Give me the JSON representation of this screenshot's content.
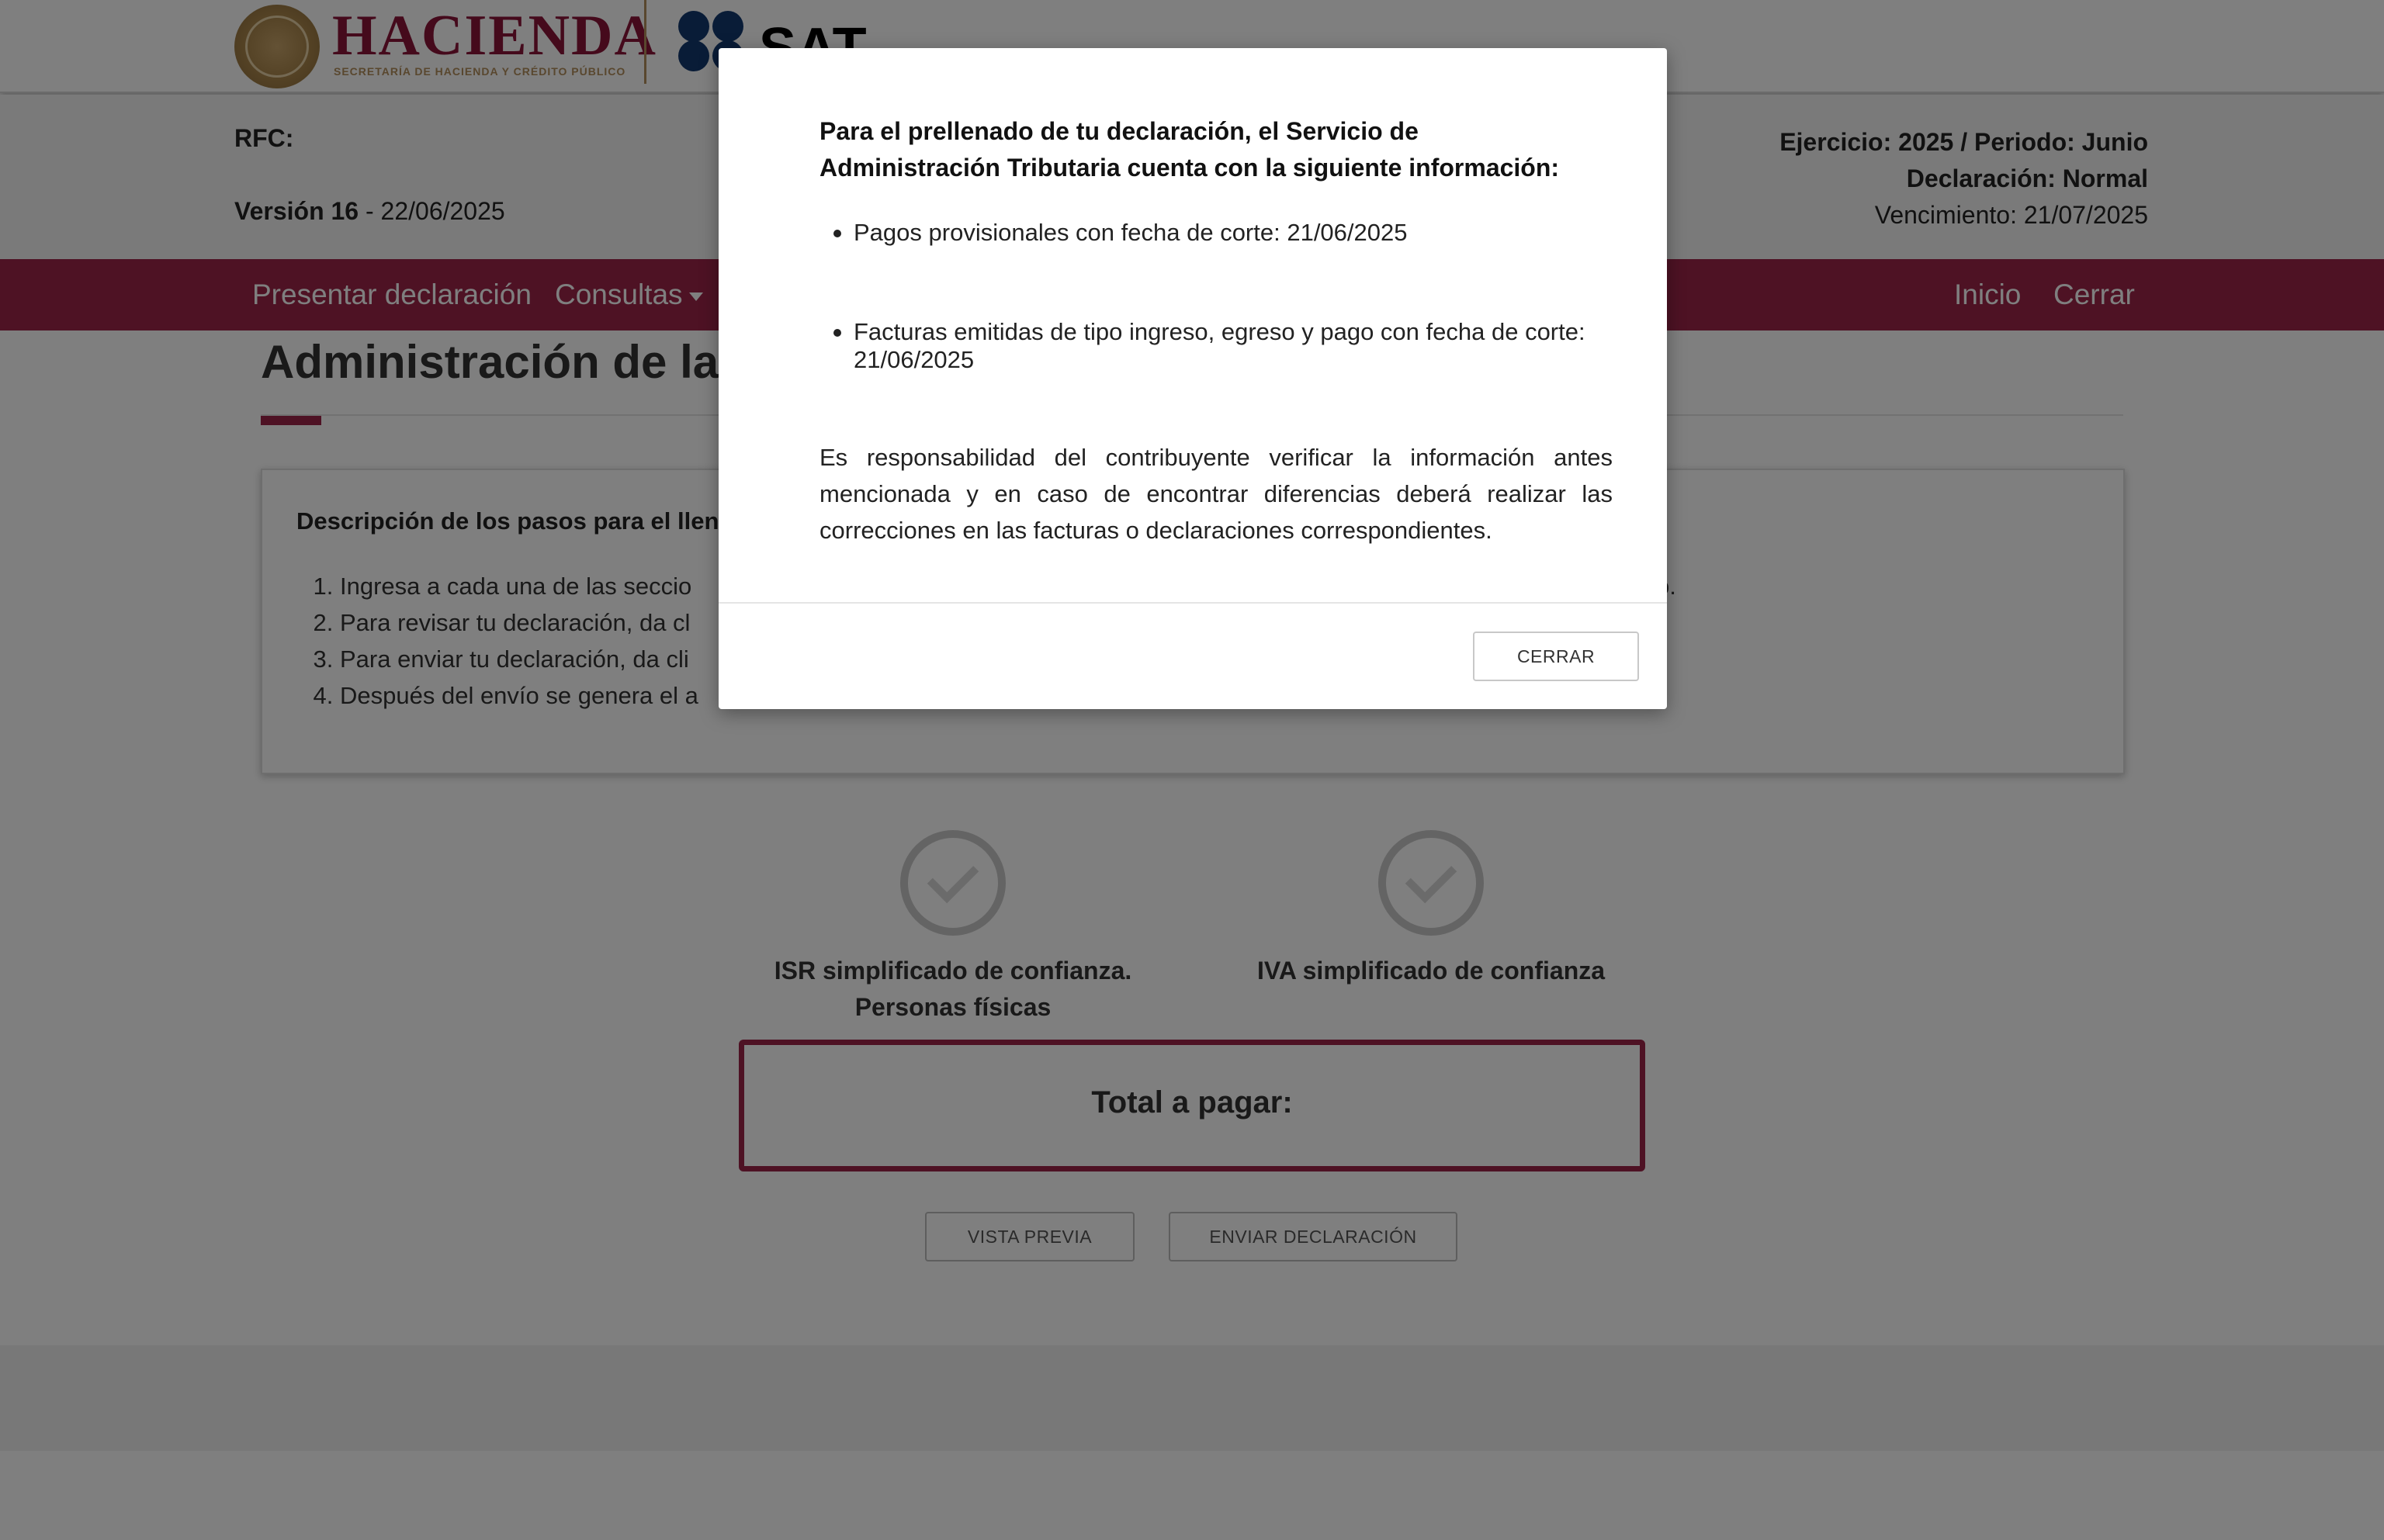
{
  "header": {
    "brand": "HACIENDA",
    "brand_subtitle": "SECRETARÍA DE HACIENDA Y CRÉDITO PÚBLICO",
    "sat_wordmark": "SAT",
    "colors": {
      "primary": "#9d2449",
      "gold": "#b38e5d",
      "sat_blue": "#13386f"
    }
  },
  "info": {
    "rfc_label": "RFC:",
    "version_label": "Versión 16",
    "version_date": " - 22/06/2025",
    "ejercicio": "Ejercicio: 2025 / Periodo: Junio",
    "declaracion": "Declaración: Normal",
    "vencimiento": "Vencimiento: 21/07/2025"
  },
  "nav": {
    "presentar": "Presentar declaración",
    "consultas": "Consultas",
    "inicio": "Inicio",
    "cerrar": "Cerrar"
  },
  "main": {
    "title": "Administración de la d",
    "steps_heading": "Descripción de los pasos para el llen",
    "steps": [
      "Ingresa a cada una de las seccio",
      "Para revisar tu declaración, da cl",
      "Para enviar tu declaración, da cli",
      "Después del envío se genera el a"
    ],
    "steps_tail": "o.",
    "sections": [
      {
        "label": "ISR simplificado de confianza. Personas físicas"
      },
      {
        "label": "IVA simplificado de confianza"
      }
    ],
    "total_label": "Total a pagar:",
    "preview_button": "VISTA PREVIA",
    "send_button": "ENVIAR DECLARACIÓN"
  },
  "modal": {
    "intro": "Para el prellenado de tu declaración, el Servicio de Administración Tributaria cuenta con la siguiente información:",
    "bullets": [
      "Pagos provisionales con fecha de corte: 21/06/2025",
      "Facturas emitidas de tipo ingreso, egreso y pago con fecha de corte: 21/06/2025"
    ],
    "note": "Es responsabilidad del contribuyente verificar la información antes mencionada y en caso de encontrar diferencias deberá realizar las correcciones en las facturas o declaraciones correspondientes.",
    "close_button": "CERRAR"
  }
}
